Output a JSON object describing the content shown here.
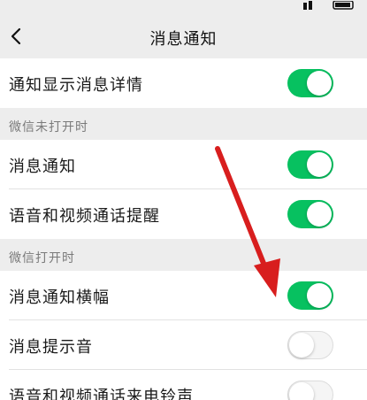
{
  "header": {
    "title": "消息通知",
    "back_icon": "chevron-left-icon"
  },
  "top_row": {
    "label": "通知显示消息详情",
    "enabled": true
  },
  "section_closed": {
    "label": "微信未打开时",
    "rows": [
      {
        "label": "消息通知",
        "enabled": true
      },
      {
        "label": "语音和视频通话提醒",
        "enabled": true
      }
    ]
  },
  "section_open": {
    "label": "微信打开时",
    "rows": [
      {
        "label": "消息通知横幅",
        "enabled": true
      },
      {
        "label": "消息提示音",
        "enabled": false
      },
      {
        "label": "语音和视频通话来电铃声",
        "enabled": false
      }
    ]
  },
  "colors": {
    "toggle_on": "#07c160",
    "toggle_off": "#f5f5f5",
    "background": "#ededed",
    "annotation_arrow": "#d81e1e"
  }
}
